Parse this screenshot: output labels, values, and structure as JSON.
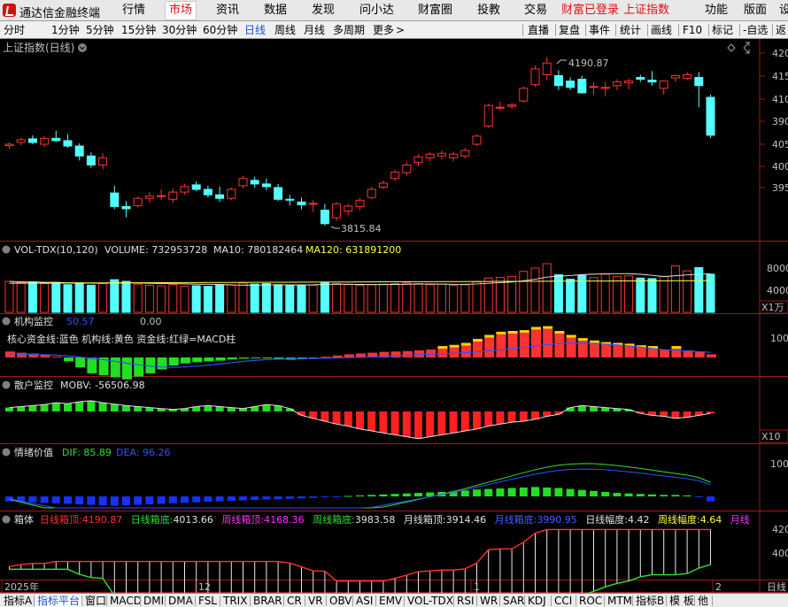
{
  "menubar": {
    "app_title": "通达信金融终端",
    "items": [
      "行情",
      "市场",
      "资讯",
      "数据",
      "发现",
      "问小达",
      "财富圈",
      "投教",
      "交易"
    ],
    "active_index": 1,
    "login_status": "财富已登录",
    "current_index": "上证指数",
    "right_items": [
      "功能",
      "版面",
      "设"
    ]
  },
  "periodbar": {
    "periods": [
      "分时",
      "1分钟",
      "5分钟",
      "15分钟",
      "30分钟",
      "60分钟",
      "日线",
      "周线",
      "月线",
      "多周期",
      "更多"
    ],
    "active_period": "日线",
    "more_arrow": ">",
    "tools": [
      "直播",
      "复盘",
      "事件",
      "统计",
      "画线",
      "F10",
      "标记",
      "-自选",
      "返"
    ]
  },
  "main": {
    "title": "上证指数(日线)",
    "y_ticks": [
      "420",
      "415",
      "410",
      "405",
      "400",
      "395",
      "390"
    ],
    "high_label": "4190.87",
    "low_label": "3815.84"
  },
  "vol": {
    "name": "VOL-TDX(10,120)",
    "volume": "VOLUME: 732953728",
    "ma10": "MA10: 780182464",
    "ma120": "MA120: 631891200",
    "y_ticks": [
      "8000",
      "4000"
    ],
    "unit": "X1万"
  },
  "inst": {
    "name": "机构监控",
    "v1": "50.57",
    "v2": "0.00",
    "legend": "核心资金线:蓝色 机构线:黄色 资金线:红绿=MACD柱",
    "y_tick": "100"
  },
  "retail": {
    "name": "散户监控",
    "mobv": "MOBV: -56506.98",
    "unit": "X10"
  },
  "emotion": {
    "name": "情绪价值",
    "dif": "DIF: 85.89",
    "dea": "DEA: 96.26",
    "y_tick": "100"
  },
  "box": {
    "name": "箱体",
    "parts": [
      {
        "label": "日线箱顶:",
        "value": "4190.87",
        "color": "#ff3030"
      },
      {
        "label": "日线箱底:",
        "value": "4013.66",
        "color": "#30e030"
      },
      {
        "label": "周线箱顶:",
        "value": "4168.36",
        "color": "#ff30ff"
      },
      {
        "label": "周线箱底:",
        "value": "3983.58",
        "color": "#30e030"
      },
      {
        "label": "月线箱顶:",
        "value": "3914.46",
        "color": "#e0e0e0"
      },
      {
        "label": "月线箱底:",
        "value": "3990.95",
        "color": "#4060ff"
      },
      {
        "label": "日线幅度:",
        "value": "4.42",
        "color": "#e0e0e0"
      },
      {
        "label": "周线幅度:",
        "value": "4.64",
        "color": "#ffff40"
      },
      {
        "label": "月线",
        "value": "",
        "color": "#ff30ff"
      }
    ],
    "y_ticks": [
      "420",
      "400"
    ]
  },
  "x_axis": {
    "labels": [
      "2025年",
      "12",
      "1",
      "2"
    ],
    "right_label": "日线"
  },
  "tabbar": {
    "tabs": [
      "指标A",
      "指标平台",
      "窗口",
      "MACD",
      "DMI",
      "DMA",
      "FSL",
      "TRIX",
      "BRAR",
      "CR",
      "VR",
      "OBV",
      "ASI",
      "EMV",
      "VOL-TDX",
      "RSI",
      "WR",
      "SAR",
      "KDJ",
      "CCI",
      "ROC",
      "MTM",
      "指标B",
      "模 板",
      "他"
    ],
    "active_tab": "指标平台"
  },
  "colors": {
    "up": "#ff3232",
    "down": "#54ffff",
    "panel_border": "#a01818",
    "ma": "#e8e8e8",
    "ma120": "#ffff50"
  },
  "chart_data": {
    "type": "candlestick",
    "title": "上证指数(日线)",
    "x_labels": [
      "2025年",
      "12",
      "1",
      "2"
    ],
    "ohlc": [
      [
        3995,
        4002,
        3988,
        3998
      ],
      [
        4002,
        4012,
        3996,
        4008
      ],
      [
        4010,
        4018,
        3998,
        4002
      ],
      [
        3998,
        4016,
        3992,
        4011
      ],
      [
        4011,
        4028,
        4003,
        4006
      ],
      [
        4006,
        4020,
        3990,
        3994
      ],
      [
        3994,
        4000,
        3962,
        3972
      ],
      [
        3972,
        3980,
        3946,
        3952
      ],
      [
        3952,
        3978,
        3942,
        3968
      ],
      [
        3890,
        3906,
        3854,
        3860
      ],
      [
        3860,
        3872,
        3836,
        3855
      ],
      [
        3862,
        3882,
        3858,
        3878
      ],
      [
        3878,
        3892,
        3868,
        3883
      ],
      [
        3882,
        3898,
        3874,
        3884
      ],
      [
        3876,
        3900,
        3868,
        3892
      ],
      [
        3892,
        3910,
        3886,
        3904
      ],
      [
        3908,
        3916,
        3894,
        3898
      ],
      [
        3898,
        3906,
        3880,
        3886
      ],
      [
        3886,
        3904,
        3870,
        3878
      ],
      [
        3878,
        3902,
        3874,
        3898
      ],
      [
        3906,
        3928,
        3900,
        3922
      ],
      [
        3918,
        3926,
        3902,
        3910
      ],
      [
        3910,
        3922,
        3896,
        3904
      ],
      [
        3902,
        3910,
        3872,
        3876
      ],
      [
        3876,
        3886,
        3862,
        3874
      ],
      [
        3870,
        3880,
        3854,
        3864
      ],
      [
        3865,
        3874,
        3848,
        3867
      ],
      [
        3852,
        3866,
        3818,
        3822
      ],
      [
        3835,
        3870,
        3828,
        3866
      ],
      [
        3850,
        3866,
        3840,
        3861
      ],
      [
        3860,
        3878,
        3852,
        3874
      ],
      [
        3880,
        3904,
        3876,
        3898
      ],
      [
        3903,
        3918,
        3898,
        3912
      ],
      [
        3922,
        3942,
        3916,
        3936
      ],
      [
        3935,
        3958,
        3928,
        3952
      ],
      [
        3958,
        3976,
        3950,
        3970
      ],
      [
        3968,
        3980,
        3960,
        3976
      ],
      [
        3972,
        3984,
        3964,
        3978
      ],
      [
        3968,
        3982,
        3960,
        3976
      ],
      [
        3972,
        3990,
        3966,
        3984
      ],
      [
        3998,
        4020,
        3994,
        4016
      ],
      [
        4038,
        4088,
        4034,
        4084
      ],
      [
        4078,
        4092,
        4072,
        4080
      ],
      [
        4082,
        4090,
        4076,
        4085
      ],
      [
        4094,
        4126,
        4090,
        4122
      ],
      [
        4130,
        4172,
        4125,
        4165
      ],
      [
        4152,
        4191,
        4140,
        4178
      ],
      [
        4150,
        4162,
        4118,
        4128
      ],
      [
        4138,
        4146,
        4118,
        4124
      ],
      [
        4142,
        4150,
        4110,
        4112
      ],
      [
        4124,
        4136,
        4108,
        4126
      ],
      [
        4122,
        4136,
        4104,
        4124
      ],
      [
        4128,
        4142,
        4118,
        4136
      ],
      [
        4134,
        4144,
        4120,
        4138
      ],
      [
        4146,
        4152,
        4136,
        4142
      ],
      [
        4140,
        4160,
        4128,
        4136
      ],
      [
        4122,
        4140,
        4108,
        4138
      ],
      [
        4145,
        4152,
        4136,
        4150
      ],
      [
        4144,
        4158,
        4140,
        4152
      ],
      [
        4146,
        4158,
        4080,
        4128
      ],
      [
        4102,
        4108,
        4012,
        4018
      ]
    ],
    "ma_line": [
      4000,
      4003,
      4006,
      4005,
      4006,
      4002,
      3995,
      3985,
      3975,
      3958,
      3940,
      3926,
      3915,
      3904,
      3896,
      3894,
      3895,
      3894,
      3892,
      3891,
      3893,
      3895,
      3895,
      3893,
      3889,
      3884,
      3879,
      3870,
      3866,
      3864,
      3866,
      3870,
      3876,
      3884,
      3893,
      3904,
      3914,
      3924,
      3933,
      3943,
      3956,
      3974,
      3988,
      4003,
      4020,
      4042,
      4062,
      4080,
      4092,
      4102,
      4112,
      4118,
      4124,
      4128,
      4132,
      4134,
      4135,
      4137,
      4138,
      4138,
      4130
    ],
    "volume": [
      5600,
      5400,
      5500,
      5200,
      5400,
      5000,
      5300,
      4900,
      5200,
      5900,
      5600,
      5100,
      4900,
      4800,
      5000,
      4700,
      4800,
      4700,
      4900,
      5000,
      5300,
      5100,
      5200,
      5000,
      4900,
      4800,
      4900,
      5400,
      5200,
      5000,
      4900,
      5000,
      5100,
      5200,
      5300,
      5200,
      5000,
      5100,
      4900,
      5000,
      5500,
      6200,
      6300,
      6500,
      7400,
      8000,
      8800,
      6800,
      6000,
      6700,
      6300,
      6900,
      6500,
      6600,
      6200,
      6100,
      6500,
      8400,
      7500,
      8100,
      6900
    ],
    "inst_macd": [
      15,
      12,
      10,
      8,
      2,
      -10,
      -25,
      -40,
      -45,
      -50,
      -55,
      -48,
      -40,
      -30,
      -20,
      -15,
      -12,
      -10,
      -8,
      -5,
      -3,
      -2,
      -1,
      -5,
      -6,
      -3,
      -2,
      2,
      5,
      8,
      10,
      12,
      14,
      15,
      16,
      18,
      20,
      22,
      25,
      30,
      40,
      50,
      58,
      60,
      62,
      70,
      72,
      60,
      50,
      42,
      36,
      32,
      30,
      28,
      24,
      22,
      20,
      22,
      18,
      15,
      8
    ],
    "retail_mobv": [
      8,
      10,
      12,
      14,
      18,
      16,
      20,
      22,
      18,
      15,
      12,
      10,
      8,
      6,
      4,
      6,
      10,
      12,
      10,
      8,
      6,
      10,
      14,
      12,
      6,
      -8,
      -14,
      -20,
      -26,
      -30,
      -36,
      -40,
      -44,
      -48,
      -52,
      -56,
      -52,
      -48,
      -44,
      -40,
      -36,
      -30,
      -26,
      -22,
      -20,
      -16,
      -10,
      -6,
      8,
      12,
      10,
      8,
      6,
      4,
      -4,
      -8,
      -10,
      -14,
      -12,
      -8,
      -4
    ],
    "emotion_macd": [
      -20,
      -22,
      -24,
      -26,
      -28,
      -30,
      -32,
      -34,
      -36,
      -38,
      -36,
      -34,
      -32,
      -30,
      -28,
      -26,
      -24,
      -22,
      -20,
      -18,
      -16,
      -14,
      -12,
      -12,
      -10,
      -8,
      -6,
      -4,
      -2,
      2,
      4,
      6,
      8,
      10,
      12,
      14,
      16,
      18,
      20,
      24,
      28,
      30,
      32,
      34,
      36,
      38,
      36,
      34,
      30,
      26,
      22,
      18,
      14,
      12,
      10,
      8,
      6,
      6,
      4,
      -2,
      -20
    ]
  }
}
